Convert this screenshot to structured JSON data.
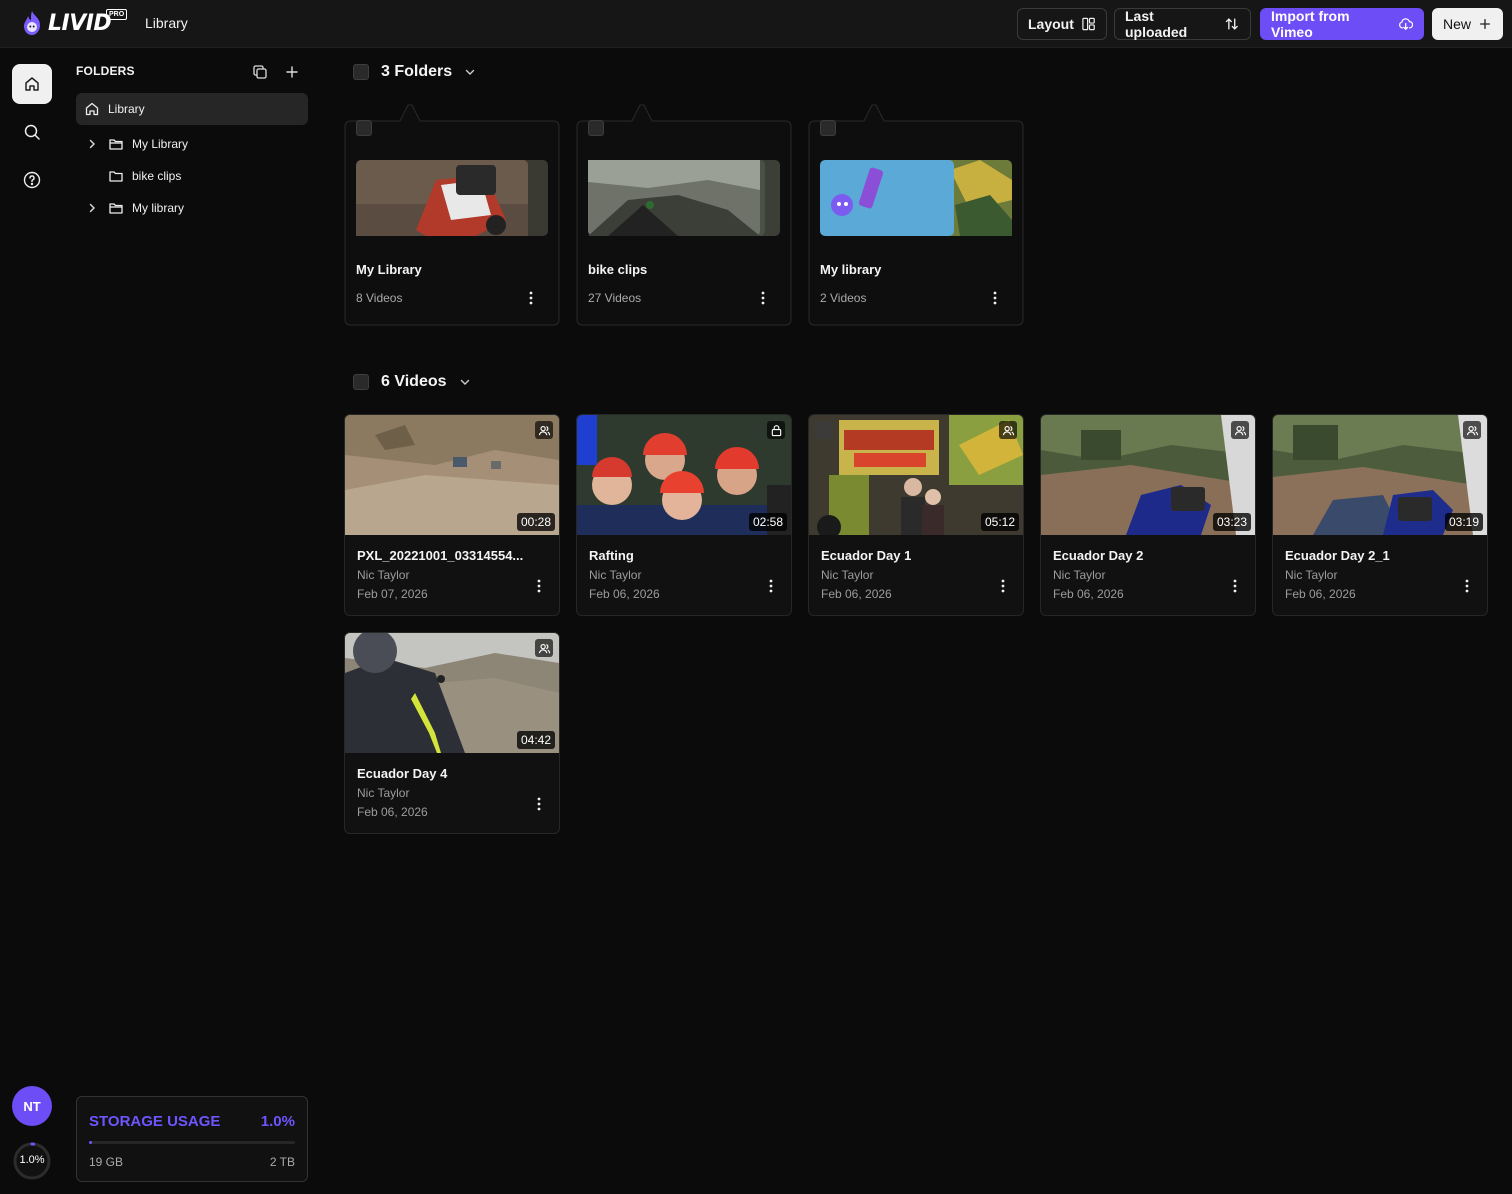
{
  "app": {
    "logo_text": "LIVID",
    "logo_badge": "PRO",
    "page_title": "Library"
  },
  "toolbar": {
    "layout_label": "Layout",
    "sort_label": "Last uploaded",
    "import_label": "Import from Vimeo",
    "new_label": "New"
  },
  "sidebar": {
    "folders_heading": "FOLDERS",
    "items": [
      {
        "label": "Library",
        "icon": "home-icon",
        "active": true
      },
      {
        "label": "My Library",
        "icon": "folder-open-icon",
        "expandable": true
      },
      {
        "label": "bike clips",
        "icon": "folder-icon",
        "expandable": false
      },
      {
        "label": "My library",
        "icon": "folder-open-icon",
        "expandable": true
      }
    ]
  },
  "folders_section": {
    "title": "3 Folders",
    "folders": [
      {
        "name": "My Library",
        "count": "8 Videos"
      },
      {
        "name": "bike clips",
        "count": "27 Videos"
      },
      {
        "name": "My library",
        "count": "2 Videos"
      }
    ]
  },
  "videos_section": {
    "title": "6 Videos",
    "videos": [
      {
        "title": "PXL_20221001_03314554...",
        "owner": "Nic Taylor",
        "date": "Feb 07, 2026",
        "duration": "00:28",
        "badge": "shared-users-icon"
      },
      {
        "title": "Rafting",
        "owner": "Nic Taylor",
        "date": "Feb 06, 2026",
        "duration": "02:58",
        "badge": "lock-icon"
      },
      {
        "title": "Ecuador Day 1",
        "owner": "Nic Taylor",
        "date": "Feb 06, 2026",
        "duration": "05:12",
        "badge": "shared-users-icon"
      },
      {
        "title": "Ecuador Day 2",
        "owner": "Nic Taylor",
        "date": "Feb 06, 2026",
        "duration": "03:23",
        "badge": "shared-users-icon"
      },
      {
        "title": "Ecuador Day 2_1",
        "owner": "Nic Taylor",
        "date": "Feb 06, 2026",
        "duration": "03:19",
        "badge": "shared-users-icon"
      },
      {
        "title": "Ecuador Day 4",
        "owner": "Nic Taylor",
        "date": "Feb 06, 2026",
        "duration": "04:42",
        "badge": "shared-users-icon"
      }
    ]
  },
  "user": {
    "initials": "NT",
    "usage_ring_label": "1.0%"
  },
  "storage": {
    "label": "STORAGE USAGE",
    "percent_label": "1.0%",
    "used_fraction": 0.01,
    "used": "19 GB",
    "total": "2 TB"
  },
  "colors": {
    "accent": "#6d4df5",
    "background": "#0b0b0b",
    "panel": "#161616"
  }
}
